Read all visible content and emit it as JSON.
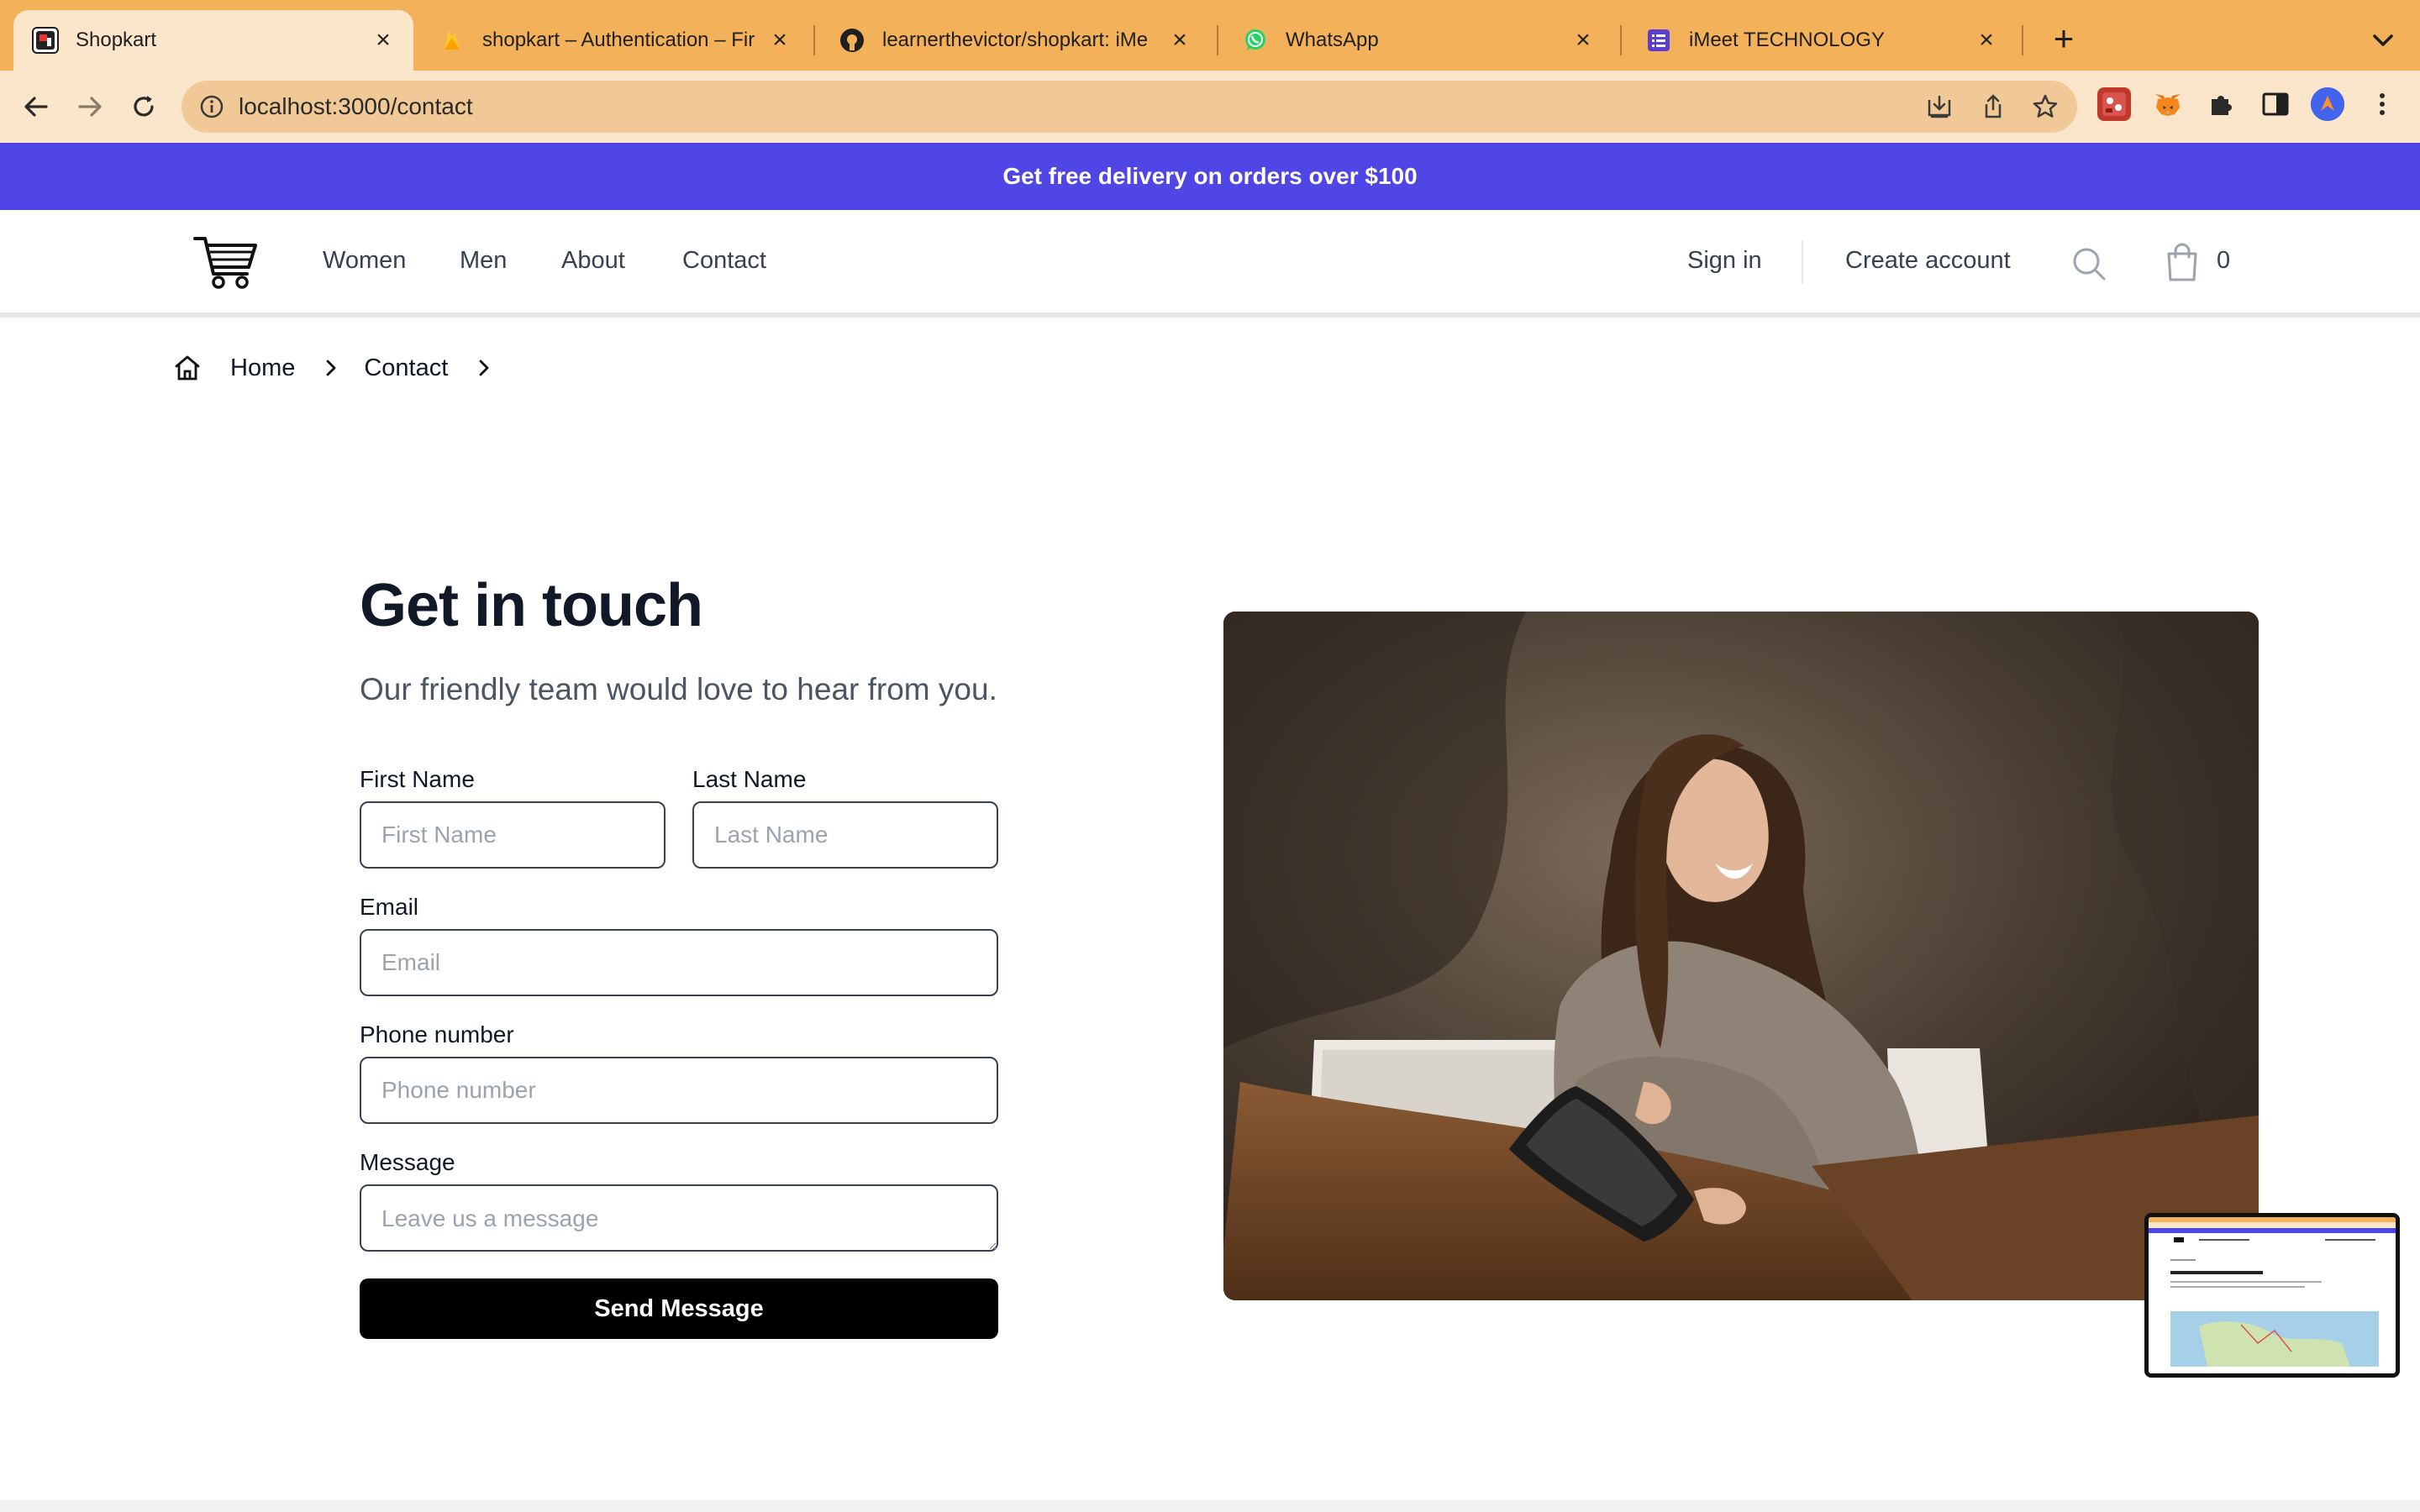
{
  "browser": {
    "tabs": [
      {
        "title": "Shopkart",
        "active": true,
        "favicon_icon": "shopkart-favicon"
      },
      {
        "title": "shopkart – Authentication – Fir",
        "active": false,
        "favicon_icon": "firebase-favicon"
      },
      {
        "title": "learnerthevictor/shopkart: iMe",
        "active": false,
        "favicon_icon": "github-favicon"
      },
      {
        "title": "WhatsApp",
        "active": false,
        "favicon_icon": "whatsapp-favicon"
      },
      {
        "title": "iMeet TECHNOLOGY",
        "active": false,
        "favicon_icon": "imeet-favicon"
      }
    ],
    "url": "localhost:3000/contact",
    "tabstrip_color": "#f3b25a",
    "toolbar_color": "#fbe6cb"
  },
  "promo": {
    "text": "Get free delivery on orders over $100",
    "color": "#4f46e5"
  },
  "nav": {
    "links": [
      "Women",
      "Men",
      "About",
      "Contact"
    ],
    "sign_in": "Sign in",
    "create_account": "Create account",
    "cart_count": "0"
  },
  "breadcrumb": {
    "items": [
      "Home",
      "Contact"
    ]
  },
  "contact": {
    "title": "Get in touch",
    "subtitle": "Our friendly team would love to hear from you.",
    "first_name": {
      "label": "First Name",
      "placeholder": "First Name",
      "value": ""
    },
    "last_name": {
      "label": "Last Name",
      "placeholder": "Last Name",
      "value": ""
    },
    "email": {
      "label": "Email",
      "placeholder": "Email",
      "value": ""
    },
    "phone": {
      "label": "Phone number",
      "placeholder": "Phone number",
      "value": ""
    },
    "message": {
      "label": "Message",
      "placeholder": "Leave us a message",
      "value": ""
    },
    "submit": "Send Message"
  }
}
